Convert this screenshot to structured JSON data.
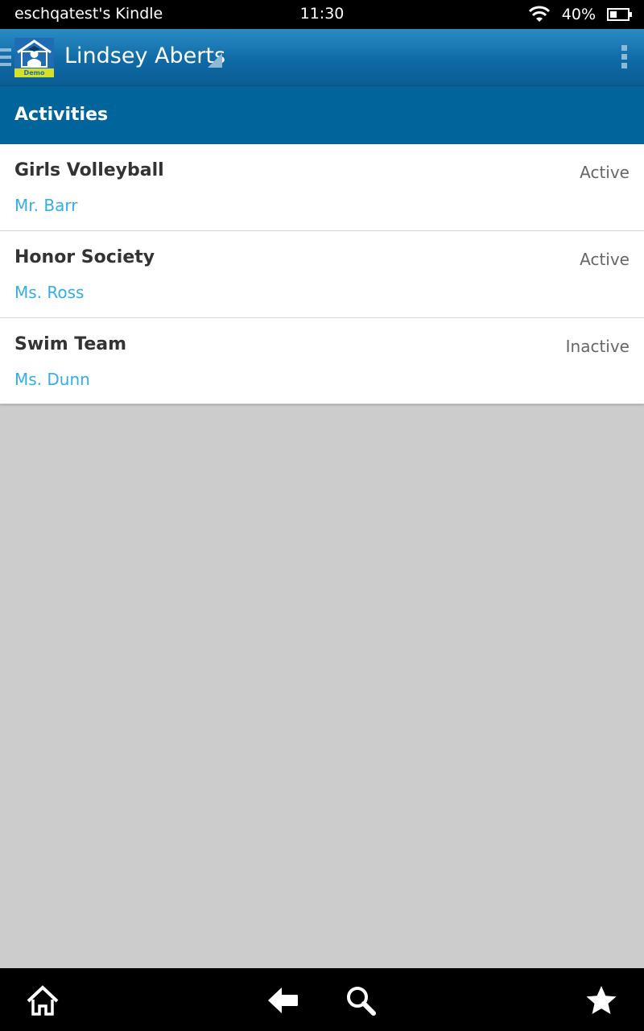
{
  "status_bar": {
    "device_name": "eschqatest's Kindle",
    "time": "11:30",
    "battery": "40%",
    "battery_level": 0.4
  },
  "action_bar": {
    "user_name": "Lindsey Aberts",
    "logo_badge": "Demo"
  },
  "section": {
    "title": "Activities"
  },
  "activities": [
    {
      "name": "Girls Volleyball",
      "status": "Active",
      "advisor": "Mr. Barr"
    },
    {
      "name": "Honor Society",
      "status": "Active",
      "advisor": "Ms. Ross"
    },
    {
      "name": "Swim Team",
      "status": "Inactive",
      "advisor": "Ms. Dunn"
    }
  ],
  "colors": {
    "header_blue": "#01659c",
    "advisor_link": "#35aee4",
    "background": "#cccccc"
  },
  "icons": {
    "bottom_nav": [
      "home-icon",
      "back-arrow-icon",
      "search-icon",
      "star-icon"
    ]
  }
}
